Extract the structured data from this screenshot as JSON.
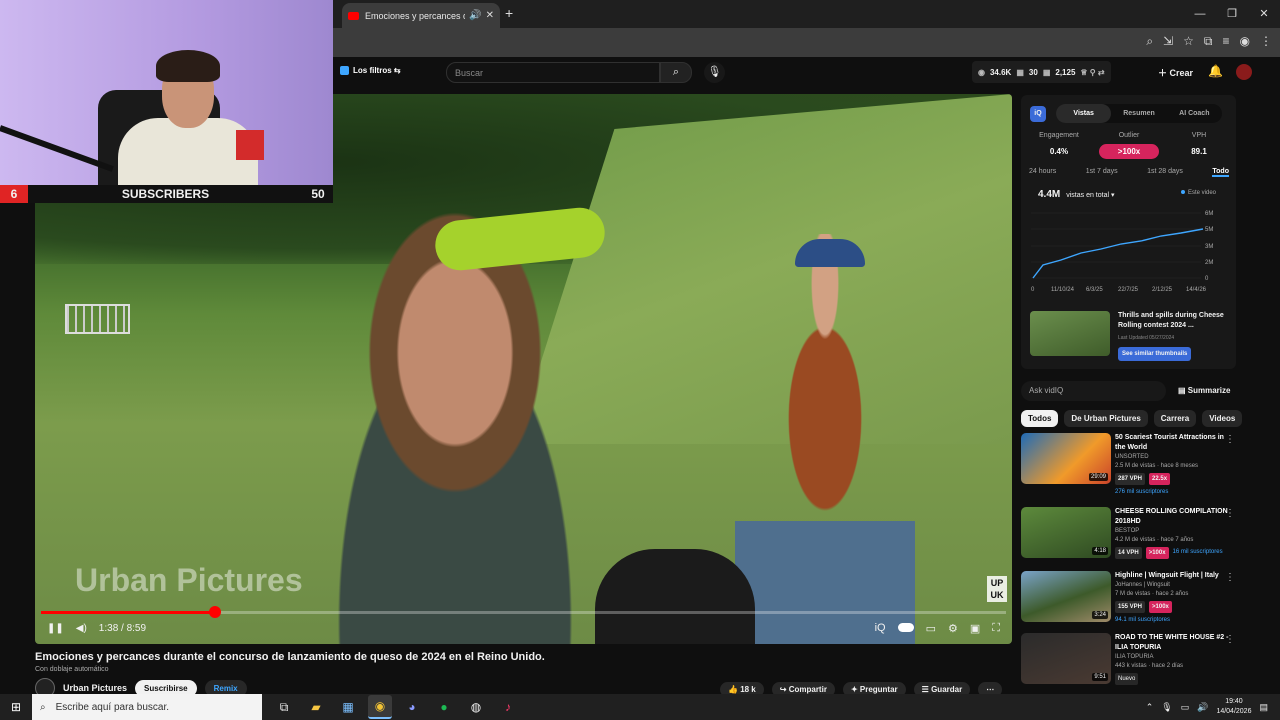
{
  "browser": {
    "tab_title": "Emociones y percances duran",
    "window_controls": [
      "—",
      "❐",
      "✕"
    ],
    "toolbar_icons": [
      "⌕",
      "⇲",
      "☆",
      "⧉",
      "≡",
      "◉",
      "⋮"
    ]
  },
  "youtube": {
    "filters_label": "Los filtros",
    "search_placeholder": "Buscar",
    "stats": [
      "34.6K",
      "30",
      "2,125"
    ],
    "create_label": "Crear"
  },
  "webcam_overlay": {
    "left_count": "6",
    "label": "SUBSCRIBERS",
    "right_count": "50"
  },
  "player": {
    "watermark": "Urban Pictures",
    "corner_badge": "UP UK",
    "time": "1:38 / 8:59",
    "progress": 0.18
  },
  "video": {
    "title": "Emociones y percances durante el concurso de lanzamiento de queso de 2024 en el Reino Unido.",
    "dubbing": "Con doblaje automático",
    "channel": "Urban Pictures",
    "subscribe_label": "Suscribirse",
    "remix_label": "Remix",
    "likes": "18 k",
    "share_label": "Compartir",
    "ask_label": "Preguntar",
    "save_label": "Guardar"
  },
  "vidiq": {
    "logo": "iQ",
    "tabs": [
      "Vistas",
      "Resumen",
      "AI Coach"
    ],
    "metrics": [
      {
        "label": "Engagement",
        "value": "0.4%"
      },
      {
        "label": "Outlier",
        "value": ">100x"
      },
      {
        "label": "VPH",
        "value": "89.1"
      }
    ],
    "ranges": [
      "24 hours",
      "1st 7 days",
      "1st 28 days",
      "Todo"
    ],
    "views_total": "4.4M",
    "views_caption": "vistas en total",
    "legend": "Este video",
    "chart": {
      "y_ticks": [
        "6M",
        "5M",
        "3M",
        "2M",
        "0"
      ],
      "x_ticks": [
        "0",
        "11/10/24",
        "6/3/25",
        "22/7/25",
        "2/12/25",
        "14/4/26"
      ]
    },
    "related_title": "Thrills and spills during Cheese Rolling contest 2024 ...",
    "related_updated": "Last Updated 05/27/2024",
    "similar_label": "See similar thumbnails"
  },
  "sidebar": {
    "ask_placeholder": "Ask vidIQ",
    "summarize_label": "Summarize",
    "chips": [
      "Todos",
      "De Urban Pictures",
      "Carrera",
      "Videos"
    ],
    "recommendations": [
      {
        "title": "50 Scariest Tourist Attractions in the World",
        "channel": "UNSORTED",
        "meta": "2.5 M de vistas · hace 8 meses",
        "vph": "287 VPH",
        "outlier": "22.5x",
        "subs": "276 mil suscriptores",
        "duration": "29:09"
      },
      {
        "title": "CHEESE ROLLING COMPILATION 2018HD",
        "channel": "BESTOP",
        "meta": "4.2 M de vistas · hace 7 años",
        "vph": "14 VPH",
        "outlier": ">100x",
        "subs": "16 mil suscriptores",
        "duration": "4:18"
      },
      {
        "title": "Highline | Wingsuit Flight | Italy",
        "channel": "JoHannes | Wingsuit",
        "meta": "7 M de vistas · hace 2 años",
        "vph": "155 VPH",
        "outlier": ">100x",
        "subs": "94.1 mil suscriptores",
        "duration": "3:24"
      },
      {
        "title": "ROAD TO THE WHITE HOUSE #2 -ILIA TOPURIA",
        "channel": "ILIA TOPURIA",
        "meta": "443 k vistas · hace 2 días",
        "badge": "Nuevo",
        "duration": "9:51"
      }
    ]
  },
  "taskbar": {
    "search_placeholder": "Escribe aquí para buscar.",
    "time": "19:40",
    "date": "14/04/2026"
  },
  "colors": {
    "accent": "#ff0000",
    "vidiq_pink": "#d6245d",
    "link_blue": "#3ea6ff"
  }
}
